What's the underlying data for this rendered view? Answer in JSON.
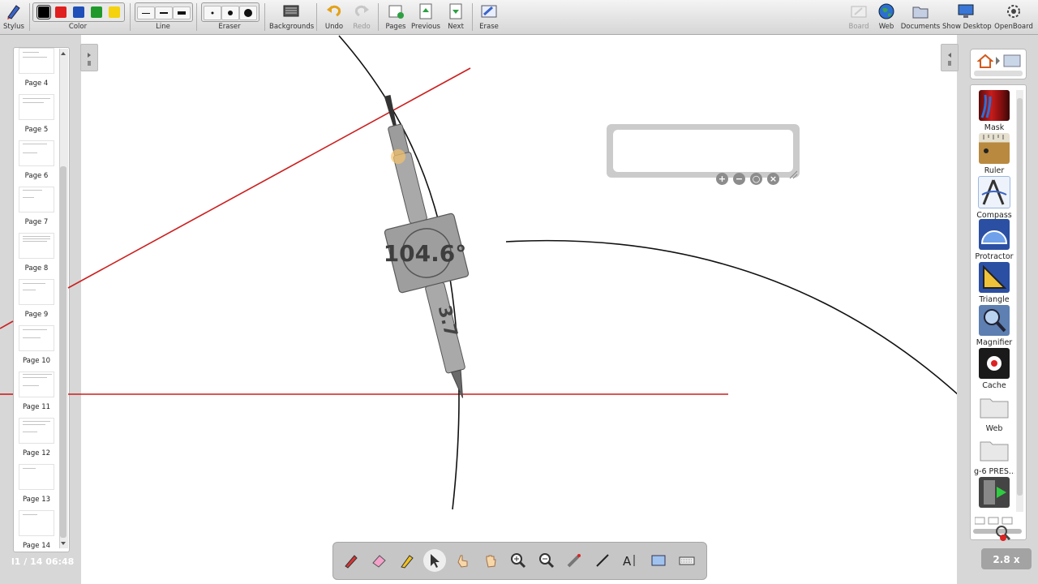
{
  "toolbar": {
    "stylus": "Stylus",
    "color": "Color",
    "line": "Line",
    "eraser": "Eraser",
    "backgrounds": "Backgrounds",
    "undo": "Undo",
    "redo": "Redo",
    "pages": "Pages",
    "previous": "Previous",
    "next": "Next",
    "erase": "Erase",
    "board": "Board",
    "web": "Web",
    "documents": "Documents",
    "show_desktop": "Show Desktop",
    "openboard": "OpenBoard",
    "colors": [
      "#000000",
      "#e01f1f",
      "#1f4fb8",
      "#1f9a2a",
      "#f4d20d"
    ]
  },
  "pages": {
    "items": [
      {
        "label": "Page 4"
      },
      {
        "label": "Page 5"
      },
      {
        "label": "Page 6"
      },
      {
        "label": "Page 7"
      },
      {
        "label": "Page 8"
      },
      {
        "label": "Page 9"
      },
      {
        "label": "Page 10"
      },
      {
        "label": "Page 11"
      },
      {
        "label": "Page 12"
      },
      {
        "label": "Page 13"
      },
      {
        "label": "Page 14"
      }
    ],
    "status": "l1 / 14",
    "clock": "06:48"
  },
  "library": {
    "items": [
      {
        "label": "Mask",
        "icon": "mask-icon"
      },
      {
        "label": "Ruler",
        "icon": "ruler-icon"
      },
      {
        "label": "Compass",
        "icon": "compass-icon"
      },
      {
        "label": "Protractor",
        "icon": "protractor-icon"
      },
      {
        "label": "Triangle",
        "icon": "triangle-icon"
      },
      {
        "label": "Magnifier",
        "icon": "magnifier-icon"
      },
      {
        "label": "Cache",
        "icon": "cache-icon"
      },
      {
        "label": "Web",
        "icon": "folder-icon"
      },
      {
        "label": "g-6 PRES...",
        "icon": "folder-icon"
      }
    ]
  },
  "canvas": {
    "compass_angle": "104.6°",
    "compass_radius": "3.7",
    "zoom": "2.8 x"
  },
  "colors": {
    "accent_red": "#cc1f1f",
    "panel_gray": "#d7d7d7"
  }
}
